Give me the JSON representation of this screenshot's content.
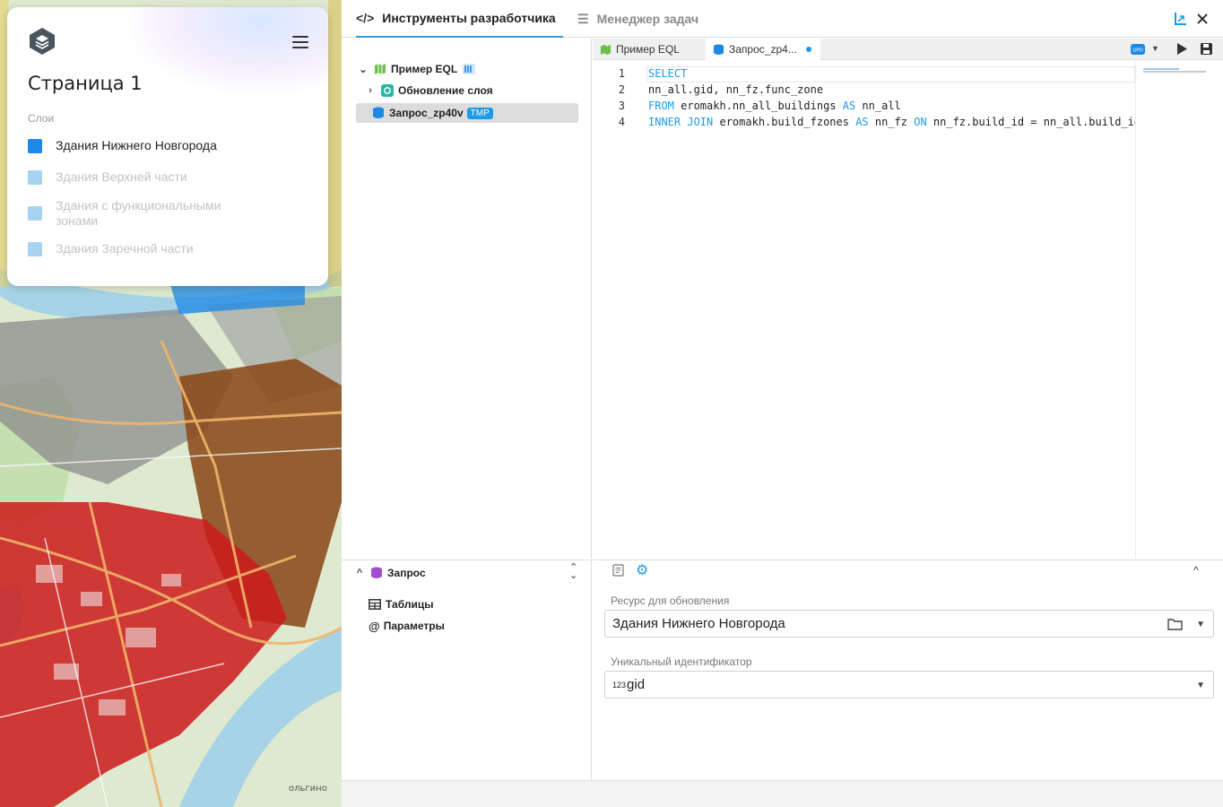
{
  "map": {
    "attribution": "ольгино"
  },
  "layer_panel": {
    "page_title": "Страница 1",
    "layers_label": "Слои",
    "layers": [
      {
        "name": "Здания Нижнего Новгорода",
        "active": true,
        "color": "#1e88e5"
      },
      {
        "name": "Здания Верхней части",
        "active": false,
        "color": "#a6d3f0"
      },
      {
        "name": "Здания с функциональными зонами",
        "active": false,
        "color": "#a6d3f0"
      },
      {
        "name": "Здания Заречной части",
        "active": false,
        "color": "#a6d3f0"
      }
    ]
  },
  "devtools": {
    "tabs": [
      {
        "label": "Инструменты разработчика",
        "icon": "code-icon",
        "active": true
      },
      {
        "label": "Менеджер задач",
        "icon": "list-icon",
        "active": false
      }
    ],
    "tree": {
      "root": "Пример EQL",
      "child_update": "Обновление слоя",
      "child_query": "Запрос_zp40v",
      "tmp_badge": "TMP"
    },
    "editor_tabs": [
      {
        "label": "Пример EQL",
        "active": false
      },
      {
        "label": "Запрос_zp4...",
        "active": true,
        "modified": true
      }
    ],
    "code_lines": [
      {
        "num": "1",
        "parts": [
          {
            "t": "SELECT",
            "kw": true
          }
        ]
      },
      {
        "num": "2",
        "parts": [
          {
            "t": "nn_all.gid, nn_fz.func_zone",
            "kw": false
          }
        ]
      },
      {
        "num": "3",
        "parts": [
          {
            "t": "FROM",
            "kw": true
          },
          {
            "t": " eromakh.nn_all_buildings ",
            "kw": false
          },
          {
            "t": "AS",
            "kw": true
          },
          {
            "t": " nn_all",
            "kw": false
          }
        ]
      },
      {
        "num": "4",
        "parts": [
          {
            "t": "INNER JOIN",
            "kw": true
          },
          {
            "t": " eromakh.build_fzones ",
            "kw": false
          },
          {
            "t": "AS",
            "kw": true
          },
          {
            "t": " nn_fz ",
            "kw": false
          },
          {
            "t": "ON",
            "kw": true
          },
          {
            "t": " nn_fz.build_id = nn_all.build_id",
            "kw": false
          }
        ]
      }
    ],
    "query_panel": {
      "title": "Запрос",
      "items": [
        "Таблицы",
        "Параметры"
      ]
    },
    "form": {
      "resource_label": "Ресурс для обновления",
      "resource_value": "Здания Нижнего Новгорода",
      "uid_label": "Уникальный идентификатор",
      "uid_type": "123",
      "uid_value": "gid"
    },
    "accent": "#1e9be8"
  }
}
